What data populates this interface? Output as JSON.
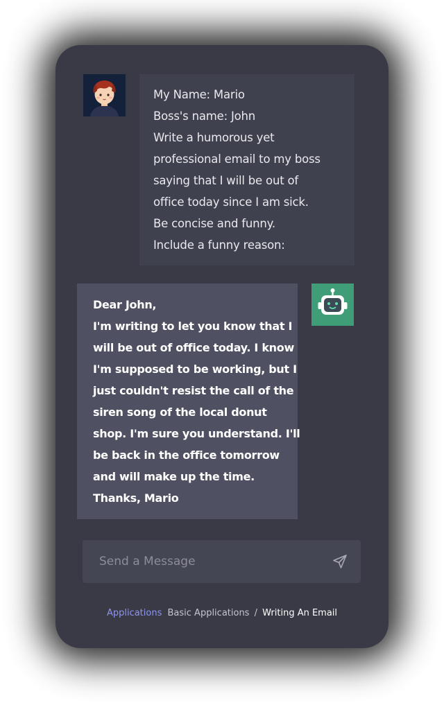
{
  "chat": {
    "user_message_lines": [
      "My Name: Mario",
      "Boss's name: John",
      "Write a humorous yet",
      "professional email to my boss",
      "saying that I will be out of",
      "office today since I am sick.",
      "Be concise and funny.",
      "Include a funny reason:"
    ],
    "bot_message_lines": [
      "Dear John,",
      "I'm writing to let you know that I",
      "will be out of office today. I know",
      "I'm supposed to be working, but I",
      "just couldn't resist the call of the",
      "siren song of the local donut",
      "shop. I'm sure you understand. I'll",
      "be back in the office tomorrow",
      "and will make up the time.",
      "Thanks, Mario"
    ]
  },
  "input": {
    "placeholder": "Send a Message",
    "value": ""
  },
  "breadcrumb": {
    "root": "Applications",
    "section": "Basic Applications",
    "separator": "/",
    "current": "Writing An Email"
  },
  "icons": {
    "user_avatar": "user-avatar-icon",
    "bot_avatar": "robot-icon",
    "send": "send-icon"
  },
  "colors": {
    "panel_bg": "#393a45",
    "user_bubble_bg": "#40414e",
    "bot_bubble_bg": "#4f5163",
    "bot_avatar_bg": "#3f9e78",
    "link_accent": "#8e95ef"
  }
}
